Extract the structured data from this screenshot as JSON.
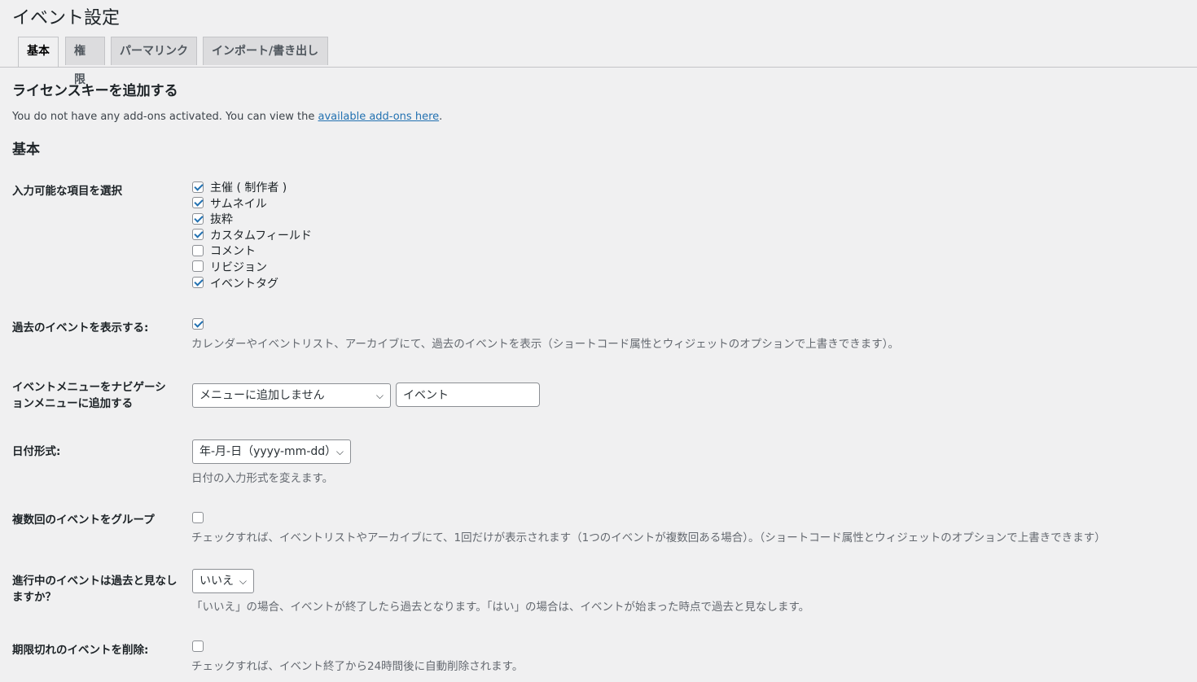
{
  "page_title": "イベント設定",
  "tabs": [
    {
      "label": "基本",
      "active": true
    },
    {
      "label": "権限",
      "active": false
    },
    {
      "label": "パーマリンク",
      "active": false
    },
    {
      "label": "インポート/書き出し",
      "active": false
    }
  ],
  "license": {
    "heading": "ライセンスキーを追加する",
    "notice_text": "You do not have any add-ons activated. You can view the ",
    "notice_link": "available add-ons here",
    "notice_end": "."
  },
  "basic_heading": "基本",
  "supports": {
    "label": "入力可能な項目を選択",
    "options": [
      {
        "label": "主催 ( 制作者 )",
        "checked": true
      },
      {
        "label": "サムネイル",
        "checked": true
      },
      {
        "label": "抜粋",
        "checked": true
      },
      {
        "label": "カスタムフィールド",
        "checked": true
      },
      {
        "label": "コメント",
        "checked": false
      },
      {
        "label": "リビジョン",
        "checked": false
      },
      {
        "label": "イベントタグ",
        "checked": true
      }
    ]
  },
  "show_past": {
    "label": "過去のイベントを表示する:",
    "checked": true,
    "description": "カレンダーやイベントリスト、アーカイブにて、過去のイベントを表示（ショートコード属性とウィジェットのオプションで上書きできます）。"
  },
  "nav_menu": {
    "label": "イベントメニューをナビゲーションメニューに追加する",
    "select_value": "メニューに追加しません",
    "input_value": "イベント"
  },
  "date_format": {
    "label": "日付形式:",
    "select_value": "年-月-日（yyyy-mm-dd）",
    "description": "日付の入力形式を変えます。"
  },
  "group_recurring": {
    "label": "複数回のイベントをグループ",
    "checked": false,
    "description": "チェックすれば、イベントリストやアーカイブにて、1回だけが表示されます（1つのイベントが複数回ある場合）。（ショートコード属性とウィジェットのオプションで上書きできます）"
  },
  "ongoing_past": {
    "label": "進行中のイベントは過去と見なしますか？",
    "select_value": "いいえ",
    "description": "「いいえ」の場合、イベントが終了したら過去となります。「はい」の場合は、イベントが始まった時点で過去と見なします。"
  },
  "delete_expired": {
    "label": "期限切れのイベントを削除:",
    "checked": false,
    "description": "チェックすれば、イベント終了から24時間後に自動削除されます。"
  },
  "icons": {
    "chevron": "chevron-down-icon",
    "check": "checkmark-icon"
  }
}
